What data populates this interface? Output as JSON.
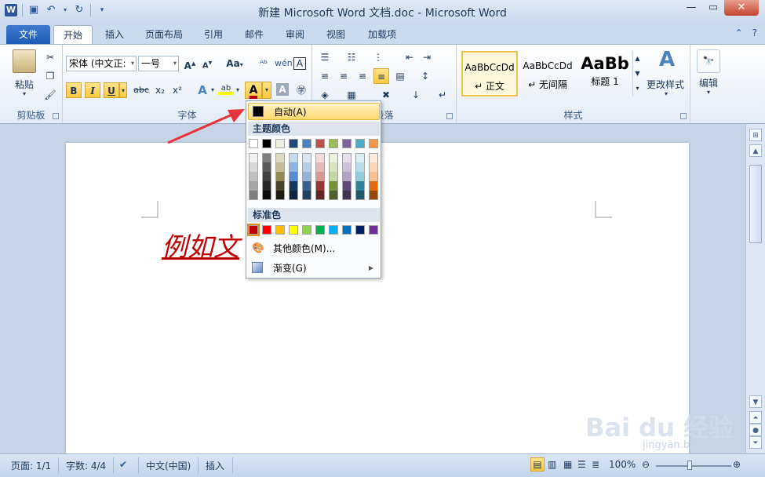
{
  "window": {
    "title": "新建 Microsoft Word 文档.doc - Microsoft Word",
    "app_icon": "W"
  },
  "tabs": {
    "file": "文件",
    "items": [
      "开始",
      "插入",
      "页面布局",
      "引用",
      "邮件",
      "审阅",
      "视图",
      "加载项"
    ]
  },
  "ribbon": {
    "clipboard": {
      "paste": "粘贴",
      "label": "剪贴板"
    },
    "font": {
      "name": "宋体 (中文正:",
      "size": "一号",
      "aa": "Aa",
      "bold": "B",
      "italic": "I",
      "underline": "U",
      "strike": "abc",
      "sub": "x₂",
      "sup": "x²",
      "label": "字体"
    },
    "paragraph": {
      "label": "段落"
    },
    "styles": {
      "items": [
        {
          "sample": "AaBbCcDd",
          "name": "↵ 正文"
        },
        {
          "sample": "AaBbCcDd",
          "name": "↵ 无间隔"
        },
        {
          "sample": "AaBb",
          "name": "标题 1"
        }
      ],
      "change": "更改样式",
      "label": "样式"
    },
    "editing": {
      "label": "编辑"
    }
  },
  "document": {
    "text": "例如文"
  },
  "color_menu": {
    "auto": "自动(A)",
    "theme_header": "主题颜色",
    "standard_header": "标准色",
    "more": "其他颜色(M)...",
    "gradient": "渐变(G)",
    "theme_top": [
      "#ffffff",
      "#000000",
      "#eeece1",
      "#1f497d",
      "#4f81bd",
      "#c0504d",
      "#9bbb59",
      "#8064a2",
      "#4bacc6",
      "#f79646"
    ],
    "theme_shades": [
      [
        "#f2f2f2",
        "#d8d8d8",
        "#bfbfbf",
        "#a5a5a5",
        "#7f7f7f"
      ],
      [
        "#7f7f7f",
        "#595959",
        "#3f3f3f",
        "#262626",
        "#0c0c0c"
      ],
      [
        "#ddd9c3",
        "#c4bd97",
        "#938953",
        "#494429",
        "#1d1b10"
      ],
      [
        "#c6d9f0",
        "#8db3e2",
        "#548dd4",
        "#17365d",
        "#0f243e"
      ],
      [
        "#dbe5f1",
        "#b8cce4",
        "#95b3d7",
        "#366092",
        "#244061"
      ],
      [
        "#f2dcdb",
        "#e5b9b7",
        "#d99694",
        "#953734",
        "#632423"
      ],
      [
        "#ebf1dd",
        "#d7e3bc",
        "#c3d69b",
        "#76923c",
        "#4f6128"
      ],
      [
        "#e5e0ec",
        "#ccc1d9",
        "#b2a2c7",
        "#5f497a",
        "#3f3151"
      ],
      [
        "#dbeef3",
        "#b7dde8",
        "#92cddc",
        "#31859b",
        "#205867"
      ],
      [
        "#fdeada",
        "#fbd5b5",
        "#fac08f",
        "#e36c09",
        "#974806"
      ]
    ],
    "standard": [
      "#c00000",
      "#ff0000",
      "#ffc000",
      "#ffff00",
      "#92d050",
      "#00b050",
      "#00b0f0",
      "#0070c0",
      "#002060",
      "#7030a0"
    ]
  },
  "statusbar": {
    "page": "页面: 1/1",
    "words": "字数: 4/4",
    "lang": "中文(中国)",
    "insert": "插入",
    "zoom": "100%"
  },
  "watermark": {
    "main": "Bai du 经验",
    "sub": "jingyan.baidu.com"
  },
  "colors": {
    "accent": "#2b579a",
    "doc_text": "#c00000",
    "annot_arrow": "#e8323c"
  }
}
